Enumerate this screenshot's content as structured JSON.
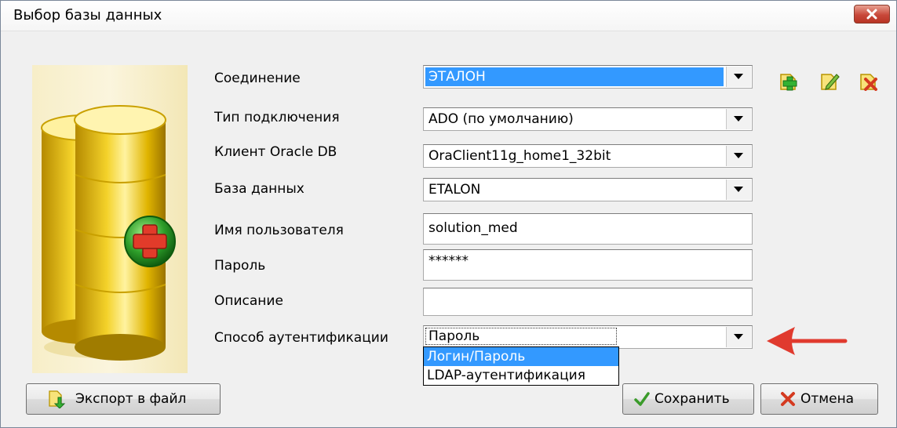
{
  "window": {
    "title": "Выбор базы данных"
  },
  "form": {
    "connection": {
      "label": "Соединение",
      "value": "ЭТАЛОН"
    },
    "connection_type": {
      "label": "Тип подключения",
      "value": "ADO (по умолчанию)"
    },
    "oracle_client": {
      "label": "Клиент Oracle DB",
      "value": "OraClient11g_home1_32bit"
    },
    "database": {
      "label": "База данных",
      "value": "ETALON"
    },
    "username": {
      "label": "Имя пользователя",
      "value": "solution_med"
    },
    "password": {
      "label": "Пароль",
      "value": "******"
    },
    "description": {
      "label": "Описание",
      "value": ""
    },
    "auth_method": {
      "label": "Способ аутентификации",
      "value": "Пароль",
      "options": [
        "Логин/Пароль",
        "LDAP-аутентификация"
      ],
      "highlighted": "Логин/Пароль"
    }
  },
  "toolbar": {
    "add_icon": "add-connection-icon",
    "edit_icon": "edit-connection-icon",
    "delete_icon": "delete-connection-icon"
  },
  "buttons": {
    "export_label": "Экспорт в файл",
    "save_label": "Сохранить",
    "cancel_label": "Отмена"
  },
  "colors": {
    "selection": "#3399ff",
    "annotation_arrow": "#e03a2e",
    "close_button": "#c8483a"
  }
}
